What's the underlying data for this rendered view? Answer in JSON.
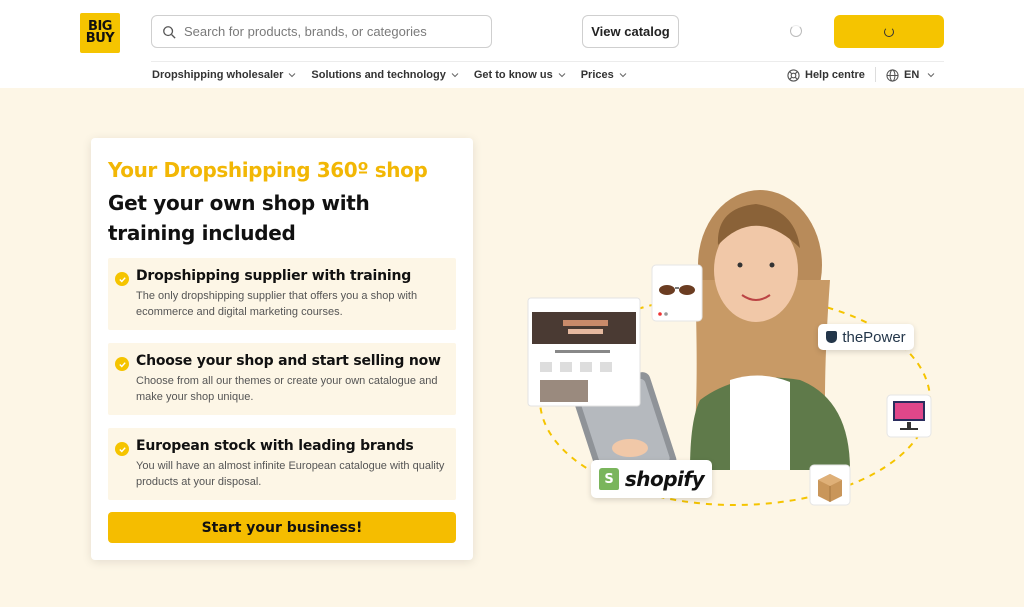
{
  "brand": {
    "logo_line1": "BIG",
    "logo_line2": "BUY"
  },
  "header": {
    "search_placeholder": "Search for products, brands, or categories",
    "catalog_button": "View catalog"
  },
  "nav": {
    "items": [
      {
        "label": "Dropshipping wholesaler"
      },
      {
        "label": "Solutions and technology"
      },
      {
        "label": "Get to know us"
      },
      {
        "label": "Prices"
      }
    ],
    "help": "Help centre",
    "language": "EN"
  },
  "hero": {
    "title_accent": "Your Dropshipping 360º shop",
    "title_main": "Get your own shop with training included",
    "features": [
      {
        "title": "Dropshipping supplier with training",
        "description": "The only dropshipping supplier that offers you a shop with ecommerce and digital marketing courses."
      },
      {
        "title": "Choose your shop and start selling now",
        "description": "Choose from all our themes or create your own catalogue and make your shop unique."
      },
      {
        "title": "European stock with leading brands",
        "description": "You will have an almost infinite European catalogue with quality products at your disposal."
      }
    ],
    "cta": "Start your business!"
  },
  "illustration": {
    "partner_1": "thePower",
    "partner_2": "shopify"
  },
  "colors": {
    "accent": "#f5c400",
    "accent_text": "#f2b705",
    "hero_bg": "#fdf6e6"
  }
}
